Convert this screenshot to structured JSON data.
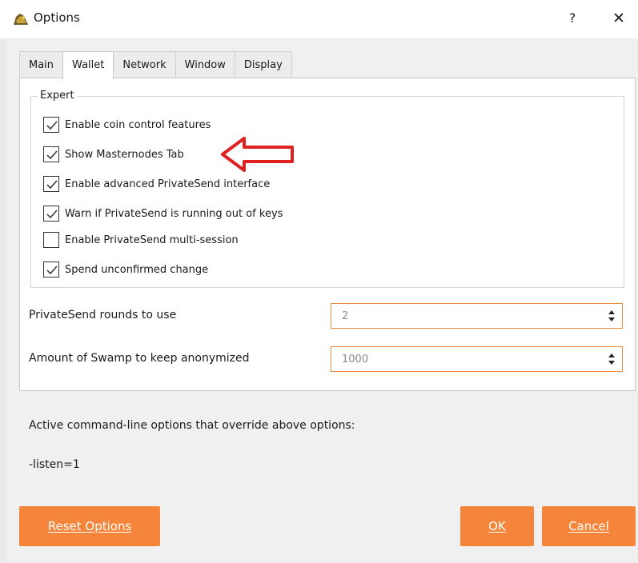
{
  "window": {
    "title": "Options",
    "help_label": "?",
    "close_label": "✕"
  },
  "tabs": [
    {
      "label": "Main",
      "active": false
    },
    {
      "label": "Wallet",
      "active": true
    },
    {
      "label": "Network",
      "active": false
    },
    {
      "label": "Window",
      "active": false
    },
    {
      "label": "Display",
      "active": false
    }
  ],
  "expert": {
    "group_label": "Expert",
    "options": [
      {
        "label": "Enable coin control features",
        "checked": true
      },
      {
        "label": "Show Masternodes Tab",
        "checked": true
      },
      {
        "label": "Enable advanced PrivateSend interface",
        "checked": true
      },
      {
        "label": "Warn if PrivateSend is running out of keys",
        "checked": true
      },
      {
        "label": "Enable PrivateSend multi-session",
        "checked": false
      },
      {
        "label": "Spend unconfirmed change",
        "checked": true
      }
    ]
  },
  "fields": {
    "rounds_label": "PrivateSend rounds to use",
    "rounds_value": "2",
    "amount_label": "Amount of Swamp to keep anonymized",
    "amount_value": "1000"
  },
  "override": {
    "title": "Active command-line options that override above options:",
    "value": "-listen=1"
  },
  "buttons": {
    "reset": "Reset Options",
    "ok": "OK",
    "cancel": "Cancel"
  },
  "annotation": {
    "arrow_color": "#e02020"
  },
  "colors": {
    "accent": "#f5853b",
    "field_border": "#f08a3c"
  }
}
